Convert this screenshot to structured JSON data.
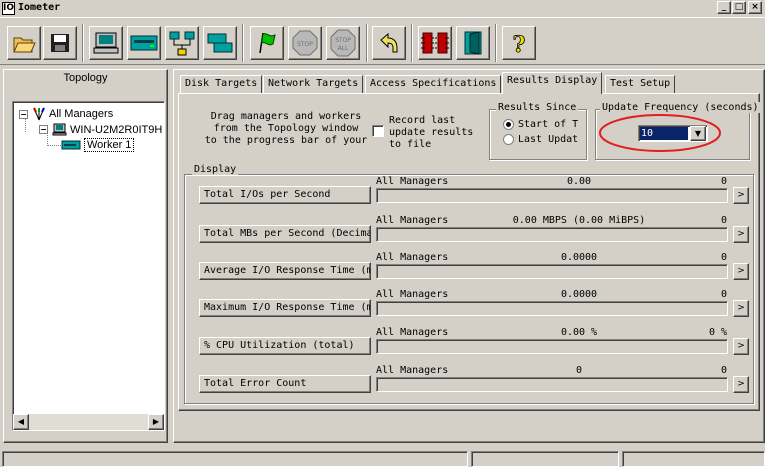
{
  "window": {
    "title": "Iometer",
    "logo_text": "IO"
  },
  "title_buttons": [
    "_",
    "□",
    "×"
  ],
  "topology": {
    "title": "Topology",
    "nodes": [
      {
        "label": "All Managers",
        "expander": "−"
      },
      {
        "label": "WIN-U2M2R0IT9H",
        "expander": "−"
      },
      {
        "label": "Worker 1",
        "selected": true
      }
    ]
  },
  "tabs": [
    {
      "label": "Disk Targets"
    },
    {
      "label": "Network Targets"
    },
    {
      "label": "Access Specifications"
    },
    {
      "label": "Results Display",
      "active": true
    },
    {
      "label": "Test Setup"
    }
  ],
  "results": {
    "drag_hint": "Drag managers and workers\nfrom the Topology window\nto the progress bar of your",
    "record_label": "Record last\nupdate results\nto file",
    "record_checked": false,
    "results_since": {
      "title": "Results Since",
      "options": [
        "Start of T",
        "Last Updat"
      ],
      "selected": 0
    },
    "update_frequency": {
      "title": "Update Frequency (seconds)",
      "value": "10"
    },
    "display_title": "Display",
    "metrics": [
      {
        "button": "Total I/Os per Second",
        "manager": "All Managers",
        "value": "0.00",
        "max": "0"
      },
      {
        "button": "Total MBs per Second (Decima",
        "manager": "All Managers",
        "value": "0.00 MBPS (0.00 MiBPS)",
        "max": "0"
      },
      {
        "button": "Average I/O Response Time (m",
        "manager": "All Managers",
        "value": "0.0000",
        "max": "0"
      },
      {
        "button": "Maximum I/O Response Time (m",
        "manager": "All Managers",
        "value": "0.0000",
        "max": "0"
      },
      {
        "button": "% CPU Utilization (total)",
        "manager": "All Managers",
        "value": "0.00 %",
        "max": "0 %"
      },
      {
        "button": "Total Error Count",
        "manager": "All Managers",
        "value": "0",
        "max": "0"
      }
    ],
    "more_label": ">"
  },
  "colors": {
    "highlight": "#0a246a",
    "annotation_circle": "#e02020"
  }
}
